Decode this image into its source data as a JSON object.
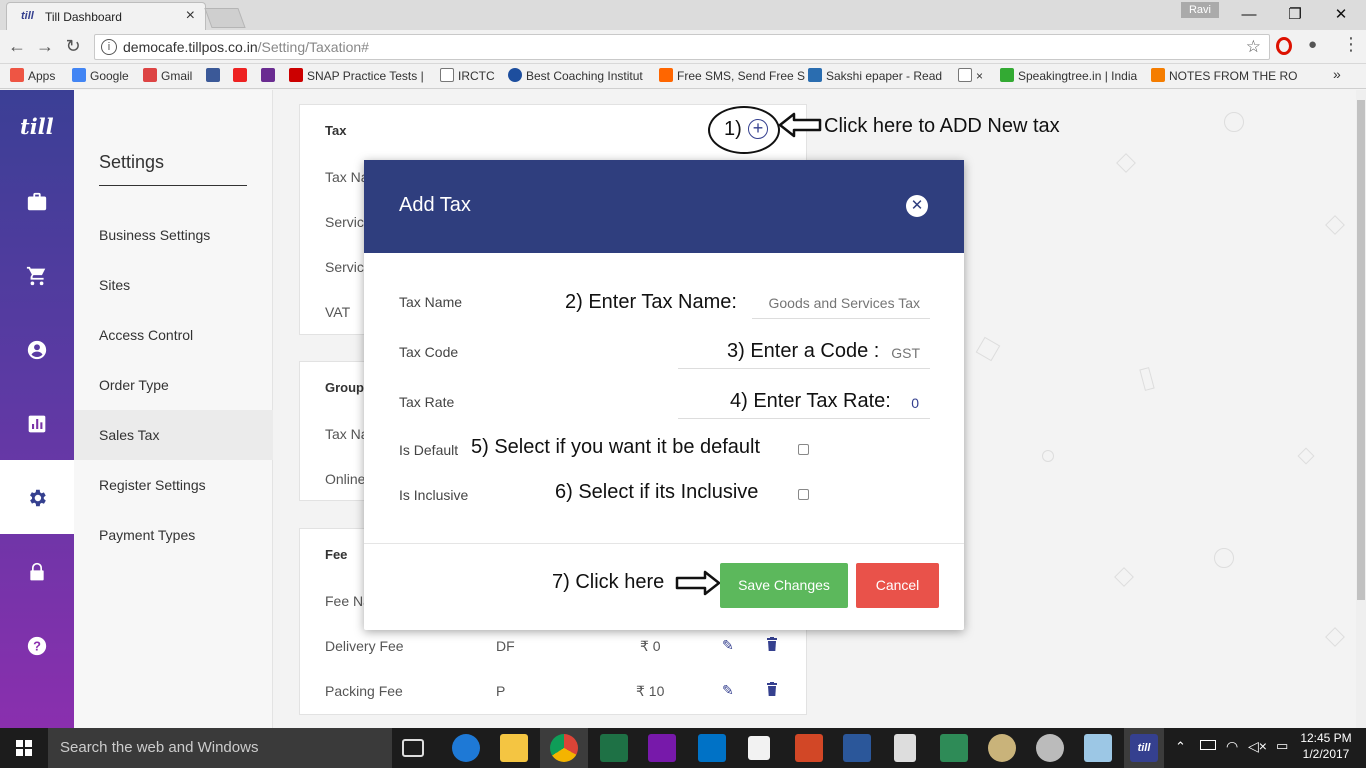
{
  "browser": {
    "tab_title": "Till Dashboard",
    "tab_favicon": "till",
    "profile_name": "Ravi",
    "url_host": "democafe.tillpos.co.in",
    "url_path": "/Setting/Taxation#",
    "bookmarks": [
      {
        "label": "Apps",
        "color": "#e54"
      },
      {
        "label": "Google",
        "color": "#4285f4"
      },
      {
        "label": "Gmail",
        "color": "#d44"
      },
      {
        "label": "",
        "color": "#3b5998"
      },
      {
        "label": "",
        "color": "#e22"
      },
      {
        "label": "",
        "color": "#6a2c91"
      },
      {
        "label": "SNAP Practice Tests |",
        "color": "#c00"
      },
      {
        "label": "IRCTC",
        "color": "#fff"
      },
      {
        "label": "Best Coaching Institut",
        "color": "#1d4e9e"
      },
      {
        "label": "Free SMS, Send Free S",
        "color": "#f60"
      },
      {
        "label": "Sakshi epaper - Read",
        "color": "#2a6db0"
      },
      {
        "label": "×",
        "color": "#fff"
      },
      {
        "label": "Speakingtree.in | India",
        "color": "#3a3"
      },
      {
        "label": "NOTES FROM THE RO",
        "color": "#f57d00"
      }
    ],
    "more": "»"
  },
  "app": {
    "logo": "till",
    "rail_icons": [
      "briefcase-icon",
      "cart-icon",
      "account-icon",
      "chart-icon",
      "gear-icon",
      "lock-icon",
      "help-icon"
    ],
    "settings_title": "Settings",
    "settings_nav": [
      "Business Settings",
      "Sites",
      "Access Control",
      "Order Type",
      "Sales Tax",
      "Register Settings",
      "Payment Types"
    ],
    "tax_card": {
      "title": "Tax",
      "rows": [
        "Tax Na",
        "Servic",
        "Servic",
        "VAT"
      ]
    },
    "group_card": {
      "title": "Group",
      "rows": [
        "Tax Na",
        "Online"
      ]
    },
    "fee_card": {
      "title": "Fee",
      "header": "Fee Na",
      "rows": [
        {
          "name": "Delivery Fee",
          "code": "DF",
          "amount": "₹ 0"
        },
        {
          "name": "Packing Fee",
          "code": "P",
          "amount": "₹ 10"
        }
      ]
    }
  },
  "modal": {
    "title": "Add Tax",
    "fields": {
      "tax_name_label": "Tax Name",
      "tax_name_placeholder": "Goods and Services Tax",
      "tax_code_label": "Tax Code",
      "tax_code_placeholder": "GST",
      "tax_rate_label": "Tax Rate",
      "tax_rate_value": "0",
      "is_default_label": "Is Default",
      "is_inclusive_label": "Is Inclusive"
    },
    "save_label": "Save Changes",
    "cancel_label": "Cancel"
  },
  "annotations": {
    "step1_num": "1)",
    "step1": "Click here to ADD New tax",
    "step2": "2) Enter Tax Name:",
    "step3": "3) Enter a Code :",
    "step4": "4) Enter Tax  Rate:",
    "step5": "5) Select if you want it be default",
    "step6": "6) Select if its Inclusive",
    "step7": "7) Click here"
  },
  "taskbar": {
    "search_placeholder": "Search the web and Windows",
    "time": "12:45 PM",
    "date": "1/2/2017"
  }
}
